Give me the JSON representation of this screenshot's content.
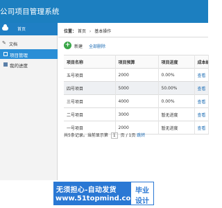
{
  "app": {
    "title": "公司项目管理系统"
  },
  "sidebar": {
    "header_label": "首页",
    "group_label": "文档",
    "items": [
      {
        "label": "项目管理",
        "active": true
      },
      {
        "label": "我的进度",
        "active": false
      }
    ]
  },
  "breadcrumb": {
    "prefix": "位置：",
    "items": [
      "首页",
      "基本操作"
    ]
  },
  "toolbar": {
    "add_label": "新建",
    "select_all_label": "全部删除"
  },
  "table": {
    "columns": [
      "项目名称",
      "项目预算",
      "项目进度",
      "成本统计"
    ],
    "rows": [
      {
        "name": "五号项目",
        "budget": "2000",
        "progress": "0.00%",
        "action": "查看"
      },
      {
        "name": "四号项目",
        "budget": "5000",
        "progress": "50.00%",
        "action": "查看"
      },
      {
        "name": "三号项目",
        "budget": "4000",
        "progress": "0.00%",
        "action": "查看"
      },
      {
        "name": "二号项目",
        "budget": "3000",
        "progress": "暂无进度",
        "action": "查看"
      },
      {
        "name": "一号项目",
        "budget": "2000",
        "progress": "暂无进度",
        "action": "查看"
      }
    ]
  },
  "pager": {
    "summary": "共5条记录。当前显示第",
    "page": "1",
    "suffix": "页 / 1页",
    "go": "跳转"
  },
  "watermark": {
    "line1": "无须担心-自动发货",
    "line2": "www.51topmind.com",
    "badge1": "毕业",
    "badge2": "设计"
  },
  "colors": {
    "titlebar": "#1c7fc0",
    "accent": "#2a8ed6",
    "link": "#1e6db5",
    "watermark": "#2a78d4"
  }
}
